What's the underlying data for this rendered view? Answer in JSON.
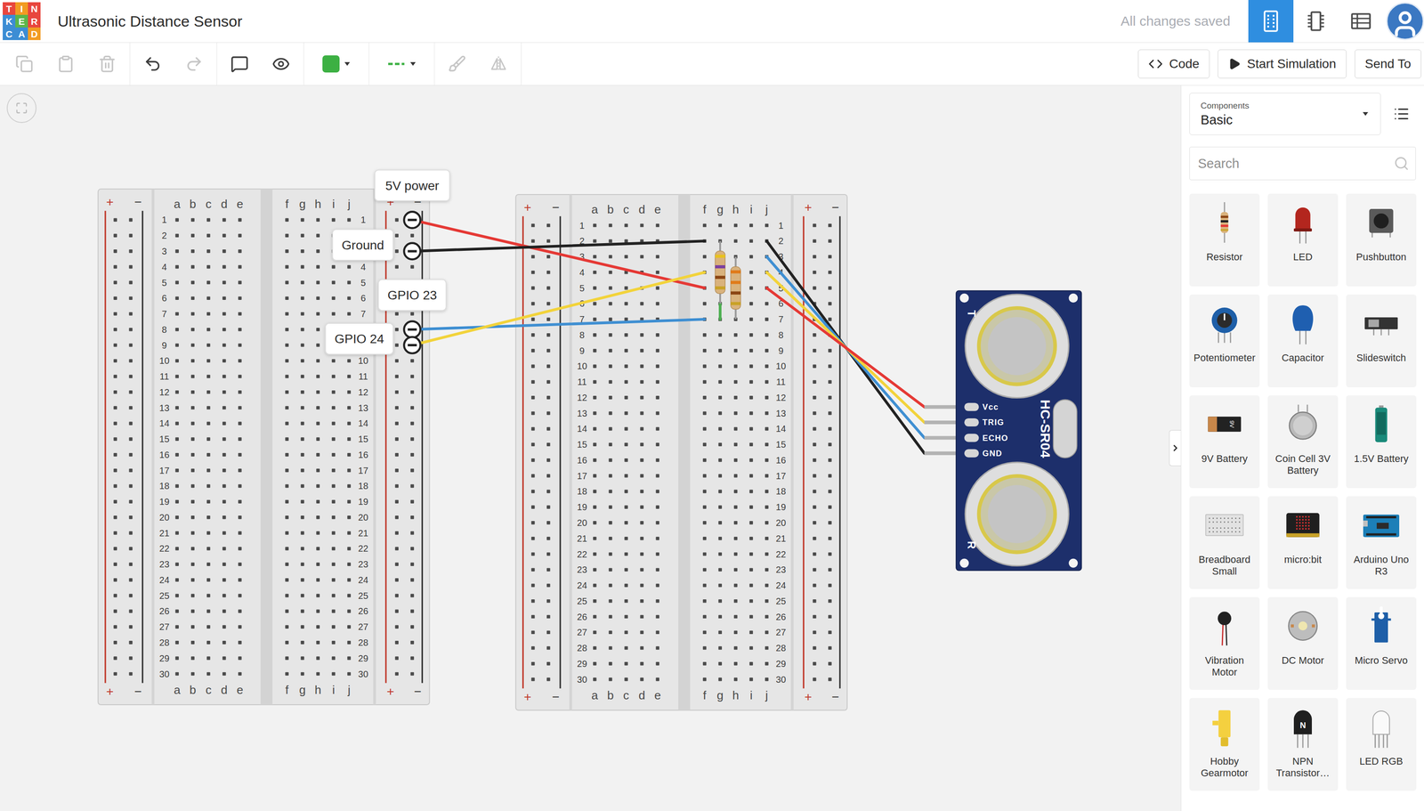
{
  "window": {
    "title": "Ultrasonic Distance Sensor"
  },
  "logo": [
    {
      "letter": "T",
      "color": "#e8463e"
    },
    {
      "letter": "I",
      "color": "#f29b22"
    },
    {
      "letter": "N",
      "color": "#e8463e"
    },
    {
      "letter": "K",
      "color": "#3c8dd4"
    },
    {
      "letter": "E",
      "color": "#5bb54a"
    },
    {
      "letter": "R",
      "color": "#e8463e"
    },
    {
      "letter": "C",
      "color": "#3c8dd4"
    },
    {
      "letter": "A",
      "color": "#3c8dd4"
    },
    {
      "letter": "D",
      "color": "#f29b22"
    }
  ],
  "save_status": "All changes saved",
  "views": [
    {
      "kind": "circuit",
      "selected": true
    },
    {
      "kind": "schematic",
      "selected": false
    },
    {
      "kind": "list",
      "selected": false
    }
  ],
  "toolbar": {
    "groups": [
      [
        {
          "kind": "copy",
          "disabled": true
        },
        {
          "kind": "paste",
          "disabled": true
        },
        {
          "kind": "delete",
          "disabled": true
        }
      ],
      [
        {
          "kind": "undo",
          "disabled": false
        },
        {
          "kind": "redo",
          "disabled": true
        }
      ],
      [
        {
          "kind": "note",
          "disabled": false
        },
        {
          "kind": "visibility",
          "disabled": false
        }
      ],
      [
        {
          "kind": "wire-color",
          "disabled": false,
          "color": "#3cb043"
        }
      ],
      [
        {
          "kind": "wire-style",
          "disabled": false,
          "color": "#3cb043"
        }
      ],
      [
        {
          "kind": "brush",
          "disabled": true
        },
        {
          "kind": "flip",
          "disabled": true
        }
      ]
    ],
    "buttons": [
      {
        "kind": "code",
        "label": "Code"
      },
      {
        "kind": "simulate",
        "label": "Start Simulation"
      },
      {
        "kind": "send",
        "label": "Send To"
      }
    ]
  },
  "canvas": {
    "breadboards": [
      {
        "columns_left": [
          "a",
          "b",
          "c",
          "d",
          "e"
        ],
        "columns_right": [
          "f",
          "g",
          "h",
          "i",
          "j"
        ],
        "rail_labels": [
          "+",
          "−"
        ],
        "rows": [
          "1",
          "2",
          "3",
          "4",
          "5",
          "6",
          "7",
          "8",
          "9",
          "10",
          "11",
          "12",
          "13",
          "14",
          "15",
          "16",
          "17",
          "18",
          "19",
          "20",
          "21",
          "22",
          "23",
          "24",
          "25",
          "26",
          "27",
          "28",
          "29",
          "30"
        ]
      },
      {
        "columns_left": [
          "a",
          "b",
          "c",
          "d",
          "e"
        ],
        "columns_right": [
          "f",
          "g",
          "h",
          "i",
          "j"
        ],
        "rail_labels": [
          "+",
          "−"
        ],
        "rows": [
          "1",
          "2",
          "3",
          "4",
          "5",
          "6",
          "7",
          "8",
          "9",
          "10",
          "11",
          "12",
          "13",
          "14",
          "15",
          "16",
          "17",
          "18",
          "19",
          "20",
          "21",
          "22",
          "23",
          "24",
          "25",
          "26",
          "27",
          "28",
          "29",
          "30"
        ]
      }
    ],
    "wires": [
      {
        "color": "#e53935",
        "from": "0:-R:1",
        "to": "1:f:5"
      },
      {
        "color": "#222222",
        "from": "0:-R:3",
        "to": "1:f:2"
      },
      {
        "color": "#3f8fd2",
        "from": "0:-R:8",
        "to": "1:f:7"
      },
      {
        "color": "#f2d33b",
        "from": "0:-R:9",
        "to": "1:f:4"
      },
      {
        "color": "#222222",
        "from": "1:j:2",
        "to": "sensor:GND"
      },
      {
        "color": "#3f8fd2",
        "from": "1:j:3",
        "to": "sensor:ECHO"
      },
      {
        "color": "#f2d33b",
        "from": "1:j:4",
        "to": "sensor:TRIG"
      },
      {
        "color": "#e53935",
        "from": "1:j:5",
        "to": "sensor:Vcc"
      },
      {
        "color": "#4caf50",
        "from": "1:g:6",
        "to": "1:g:7"
      }
    ],
    "resistors": [
      {
        "from": "1:g:2",
        "to": "1:g:6",
        "bands": [
          "#e8c21f",
          "#7b3fa0",
          "#8b4513",
          "#c9a227"
        ]
      },
      {
        "from": "1:h:3",
        "to": "1:h:7",
        "bands": [
          "#e07b1a",
          "#e07b1a",
          "#8b4513",
          "#c9a227"
        ]
      }
    ],
    "notes": [
      {
        "text": "5V power",
        "pin": "0:-R:1"
      },
      {
        "text": "Ground",
        "pin": "0:-R:3"
      },
      {
        "text": "GPIO 23",
        "pin": "0:-R:8"
      },
      {
        "text": "GPIO 24",
        "pin": "0:-R:9"
      }
    ],
    "sensor": {
      "model": "HC-SR04",
      "marks": [
        "T",
        "R"
      ],
      "pins": [
        "Vcc",
        "TRIG",
        "ECHO",
        "GND"
      ]
    }
  },
  "panel": {
    "category_label": "Components",
    "category": "Basic",
    "search": {
      "placeholder": "Search"
    },
    "components": [
      {
        "name": "Resistor",
        "kind": "resistor"
      },
      {
        "name": "LED",
        "kind": "led"
      },
      {
        "name": "Pushbutton",
        "kind": "pushbutton"
      },
      {
        "name": "Potentiometer",
        "kind": "potentiometer"
      },
      {
        "name": "Capacitor",
        "kind": "capacitor"
      },
      {
        "name": "Slideswitch",
        "kind": "slideswitch"
      },
      {
        "name": "9V Battery",
        "kind": "battery-9v",
        "mark": "9V"
      },
      {
        "name": "Coin Cell 3V Battery",
        "kind": "coin-cell"
      },
      {
        "name": "1.5V Battery",
        "kind": "battery-aa"
      },
      {
        "name": "Breadboard Small",
        "kind": "breadboard"
      },
      {
        "name": "micro:bit",
        "kind": "microbit"
      },
      {
        "name": "Arduino Uno R3",
        "kind": "arduino"
      },
      {
        "name": "Vibration Motor",
        "kind": "vibration-motor"
      },
      {
        "name": "DC Motor",
        "kind": "dc-motor"
      },
      {
        "name": "Micro Servo",
        "kind": "micro-servo"
      },
      {
        "name": "Hobby Gearmotor",
        "kind": "gearmotor"
      },
      {
        "name": "NPN Transistor…",
        "kind": "npn-transistor",
        "mark": "N"
      },
      {
        "name": "LED RGB",
        "kind": "led-rgb"
      }
    ]
  }
}
